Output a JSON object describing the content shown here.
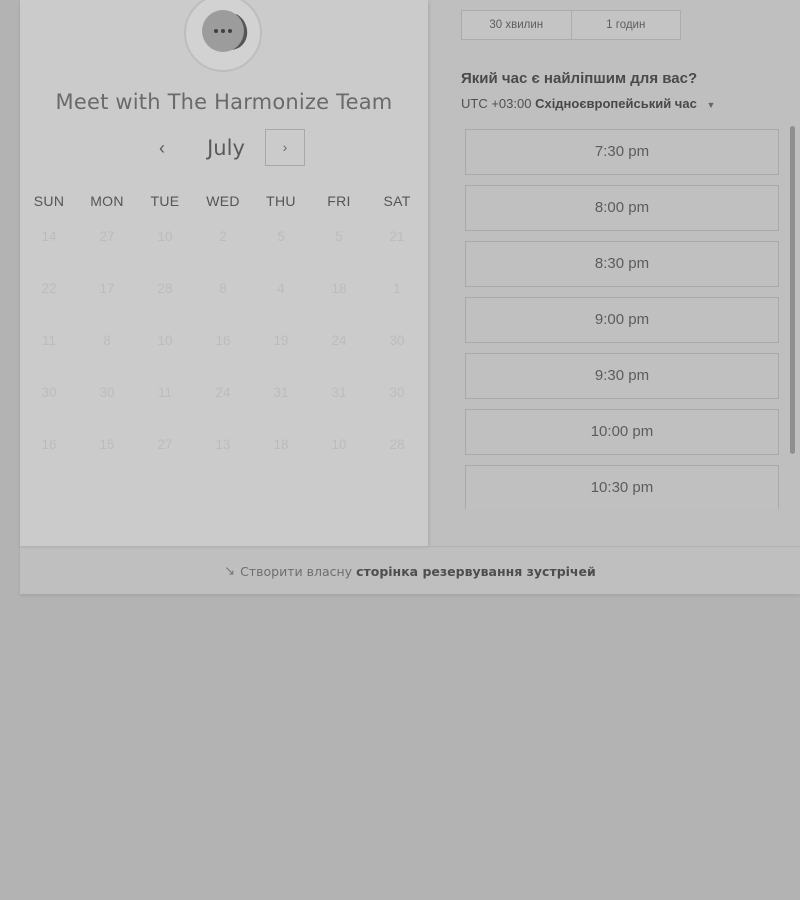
{
  "calendar": {
    "title": "Meet with The Harmonize Team",
    "month": "July",
    "prev_icon": "‹",
    "next_icon": "›",
    "weekdays": [
      "SUN",
      "MON",
      "TUE",
      "WED",
      "THU",
      "FRI",
      "SAT"
    ],
    "weeks": [
      [
        "14",
        "27",
        "10",
        "2",
        "5",
        "5",
        "21"
      ],
      [
        "22",
        "17",
        "28",
        "8",
        "4",
        "18",
        "1"
      ],
      [
        "11",
        "8",
        "10",
        "16",
        "19",
        "24",
        "30"
      ],
      [
        "30",
        "30",
        "11",
        "24",
        "31",
        "31",
        "30"
      ],
      [
        "16",
        "15",
        "27",
        "13",
        "18",
        "10",
        "28"
      ]
    ]
  },
  "duration": {
    "options": [
      "30 хвилин",
      "1 годин"
    ]
  },
  "question": "Який час є найліпшим для вас?",
  "timezone": {
    "offset": "UTC +03:00",
    "name": "Східноєвропейський час"
  },
  "slots": [
    "7:30 pm",
    "8:00 pm",
    "8:30 pm",
    "9:00 pm",
    "9:30 pm",
    "10:00 pm",
    "10:30 pm"
  ],
  "footer": {
    "prefix": "Створити власну",
    "link": "сторінка резервування зустрічей",
    "icon": "↘"
  },
  "colors": {
    "background": "#b3b3b3",
    "panel": "#cbcbcb",
    "text": "#5a5a5a"
  }
}
